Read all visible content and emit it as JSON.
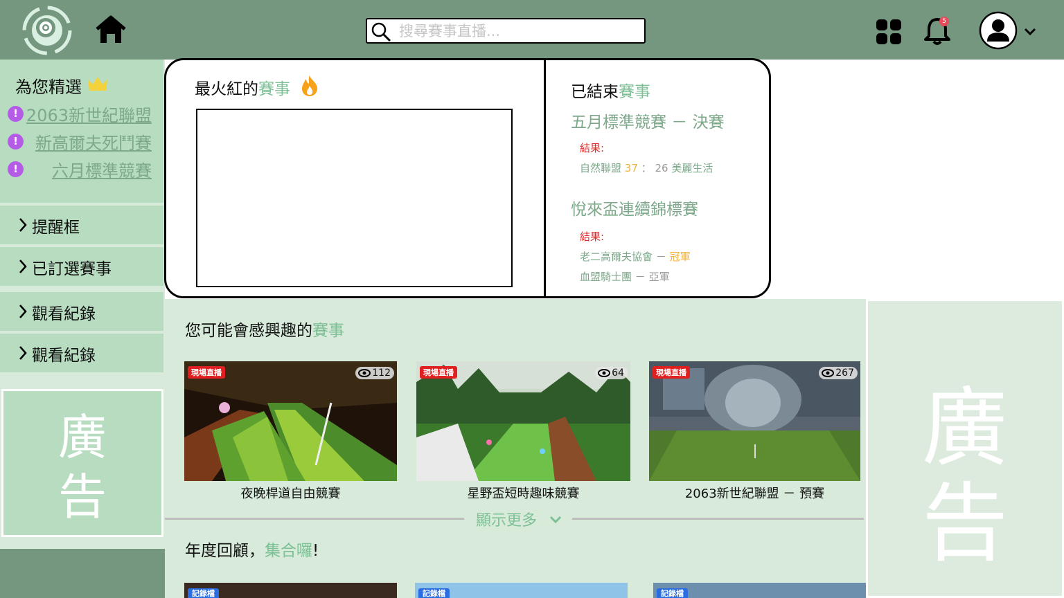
{
  "header": {
    "search_placeholder": "搜尋賽事直播...",
    "notification_count": "5",
    "icons": [
      "logo-icon",
      "home-icon",
      "search-icon",
      "apps-grid-icon",
      "bell-icon",
      "user-avatar-icon",
      "chevron-down-icon"
    ]
  },
  "sidebar": {
    "picks_title": "為您精選",
    "picks": [
      "2063新世紀聯盟",
      "新高爾夫死鬥賽",
      "六月標準競賽"
    ],
    "items": [
      "提醒框",
      "已訂選賽事",
      "觀看紀錄",
      "觀看紀錄"
    ],
    "ad_text": [
      "廣",
      "告"
    ]
  },
  "hot": {
    "title_plain": "最火紅的",
    "title_accent": "賽事"
  },
  "ended": {
    "title_plain": "已結束",
    "title_accent": "賽事",
    "events": [
      {
        "name": "五月標準競賽 － 決賽",
        "result_label": "結果:",
        "team_a": "自然聯盟",
        "score_a": "37",
        "sep": "：",
        "score_b": "26",
        "team_b": "美麗生活"
      },
      {
        "name": "悅來盃連續錦標賽",
        "result_label": "結果:",
        "first_team": "老二高爾夫協會",
        "first_dash": "－",
        "first_place": "冠軍",
        "second_team": "血盟騎士團",
        "second_dash": "－",
        "second_place": "亞軍"
      }
    ]
  },
  "recommend": {
    "title_plain": "您可能會感興趣的",
    "title_accent": "賽事",
    "live_tag": "現場直播",
    "cards": [
      {
        "title": "夜晚桿道自由競賽",
        "viewers": "112"
      },
      {
        "title": "星野盃短時趣味競賽",
        "viewers": "64"
      },
      {
        "title": "2063新世紀聯盟 － 預賽",
        "viewers": "267"
      }
    ],
    "show_more": "顯示更多"
  },
  "review": {
    "title_plain": "年度回顧，",
    "title_accent": "集合囉",
    "title_end": "!",
    "record_tag": "記錄檔"
  },
  "right_ad": {
    "text": [
      "廣",
      "告"
    ]
  },
  "colors": {
    "topbar": "#76977f",
    "sidebar_block": "#b7dcc0",
    "content_bg": "#d8ead9",
    "accent": "#7dc096",
    "gold": "#f0b23a",
    "alert_purple": "#b45ce6",
    "live_red": "#e02020",
    "record_blue": "#2a6de0"
  }
}
